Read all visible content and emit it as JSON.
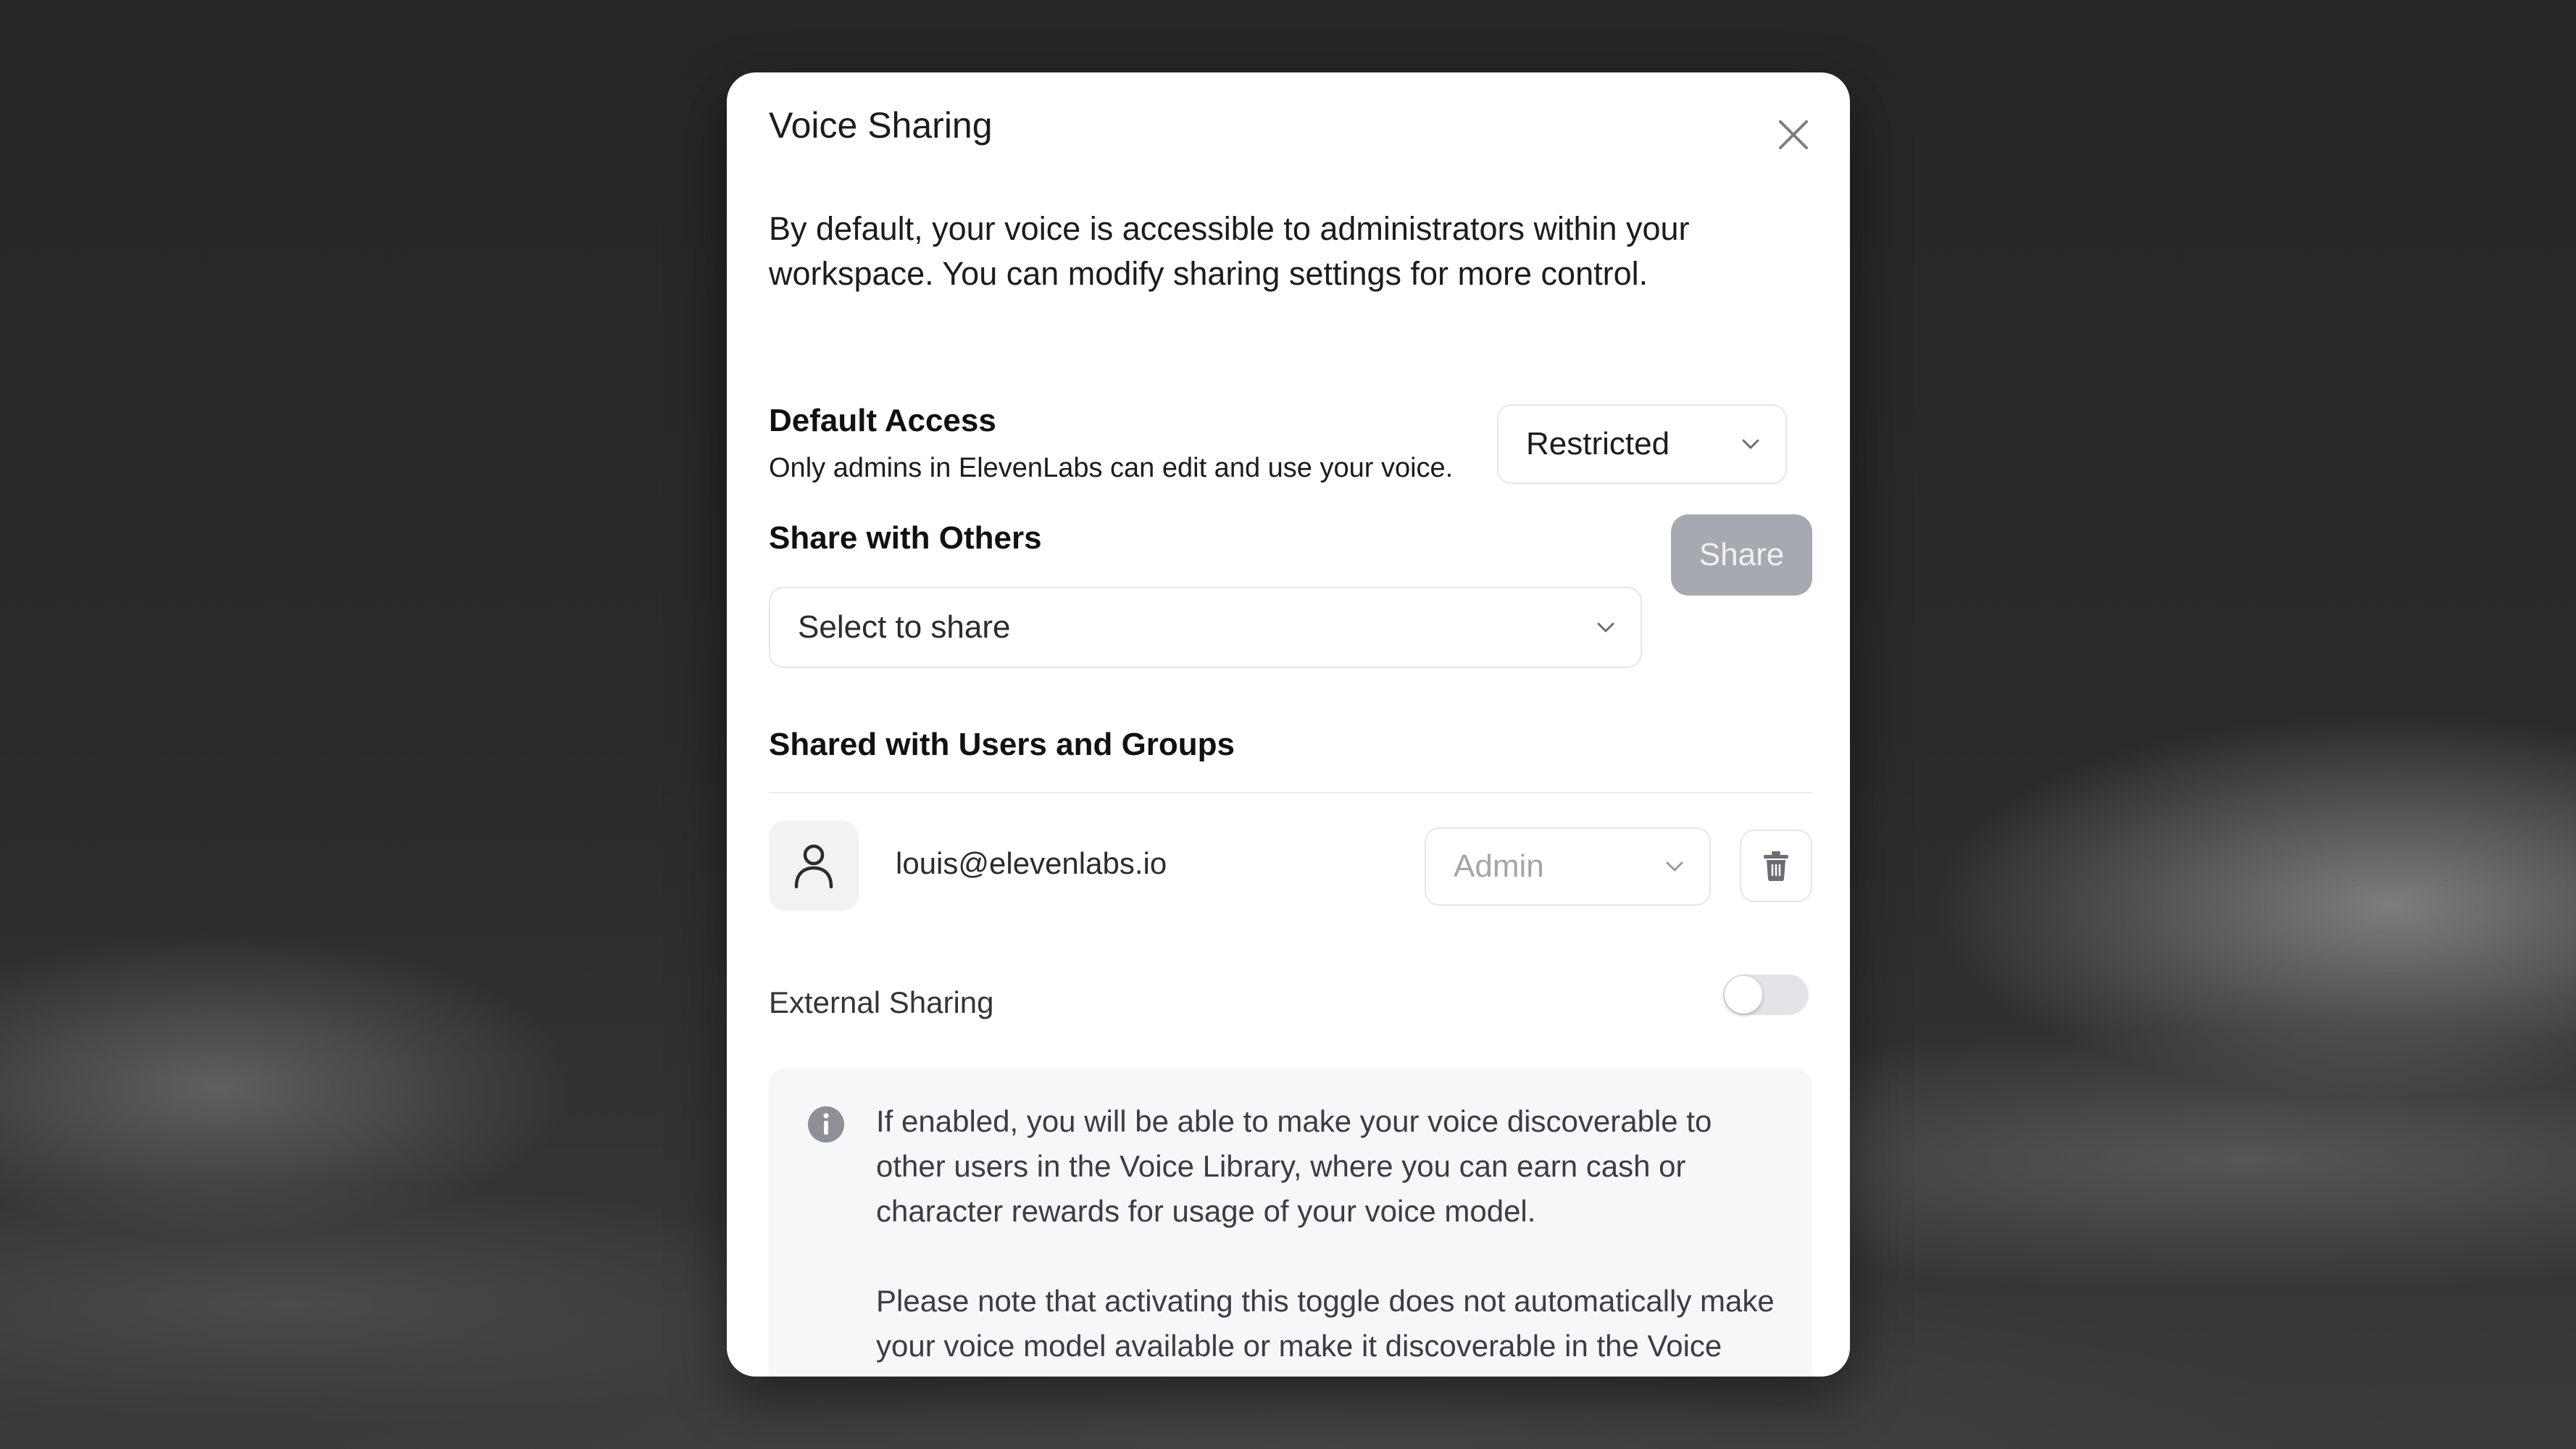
{
  "modal": {
    "title": "Voice Sharing",
    "intro": "By default, your voice is accessible to administrators within your workspace. You can modify sharing settings for more control."
  },
  "default_access": {
    "heading": "Default Access",
    "description": "Only admins in ElevenLabs can edit and use your voice.",
    "selected": "Restricted"
  },
  "share_with_others": {
    "heading": "Share with Others",
    "select_placeholder": "Select to share",
    "share_button": "Share"
  },
  "shared_with": {
    "heading": "Shared with Users and Groups",
    "entries": [
      {
        "email": "louis@elevenlabs.io",
        "role": "Admin"
      }
    ]
  },
  "external_sharing": {
    "label": "External Sharing",
    "enabled": false,
    "info_paragraphs": [
      "If enabled, you will be able to make your voice discoverable to other users in the Voice Library, where you can earn cash or character rewards for usage of your voice model.",
      "Please note that activating this toggle does not automatically make your voice model available or make it discoverable in the Voice Library."
    ]
  },
  "icons": {
    "close": "close-icon",
    "chevron": "chevron-down-icon",
    "user": "user-icon",
    "trash": "trash-icon",
    "info": "info-icon"
  },
  "colors": {
    "share_button_bg": "#a7a9b0",
    "info_box_bg": "#f6f7f9"
  }
}
